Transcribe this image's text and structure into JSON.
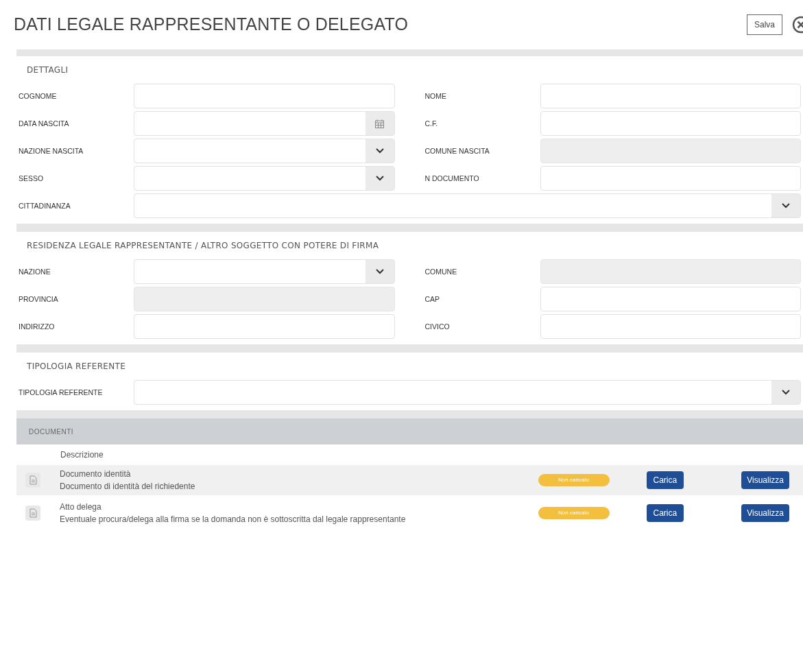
{
  "title": "DATI LEGALE RAPPRESENTANTE O DELEGATO",
  "save_button": "Salva",
  "sections": [
    {
      "title": "DETTAGLI",
      "rows": [
        [
          {
            "label": "COGNOME",
            "kind": "text"
          },
          {
            "label": "NOME",
            "kind": "text"
          }
        ],
        [
          {
            "label": "DATA NASCITA",
            "kind": "date"
          },
          {
            "label": "C.F.",
            "kind": "text"
          }
        ],
        [
          {
            "label": "NAZIONE NASCITA",
            "kind": "select"
          },
          {
            "label": "COMUNE NASCITA",
            "kind": "disabled"
          }
        ],
        [
          {
            "label": "SESSO",
            "kind": "select"
          },
          {
            "label": "N DOCUMENTO",
            "kind": "text"
          }
        ],
        [
          {
            "label": "CITTADINANZA",
            "kind": "select"
          }
        ]
      ]
    },
    {
      "title": "RESIDENZA LEGALE RAPPRESENTANTE / ALTRO SOGGETTO CON POTERE DI FIRMA",
      "rows": [
        [
          {
            "label": "NAZIONE",
            "kind": "select"
          },
          {
            "label": "COMUNE",
            "kind": "disabled"
          }
        ],
        [
          {
            "label": "PROVINCIA",
            "kind": "disabled"
          },
          {
            "label": "CAP",
            "kind": "text"
          }
        ],
        [
          {
            "label": "INDIRIZZO",
            "kind": "text"
          },
          {
            "label": "CIVICO",
            "kind": "text"
          }
        ]
      ]
    },
    {
      "title": "TIPOLOGIA REFERENTE",
      "rows": [
        [
          {
            "label": "TIPOLOGIA REFERENTE",
            "kind": "select"
          }
        ]
      ]
    }
  ],
  "documents": {
    "title": "DOCUMENTI",
    "column_header": "Descrizione",
    "rows": [
      {
        "name": "Documento identità",
        "description": "Documento di identità del richiedente",
        "status": "Non caricato",
        "upload": "Carica",
        "view": "Visualizza",
        "selected": true
      },
      {
        "name": "Atto delega",
        "description": "Eventuale procura/delega alla firma se la domanda non è sottoscritta dal legale rappresentante",
        "status": "Non caricato",
        "upload": "Carica",
        "view": "Visualizza",
        "selected": false
      }
    ]
  }
}
